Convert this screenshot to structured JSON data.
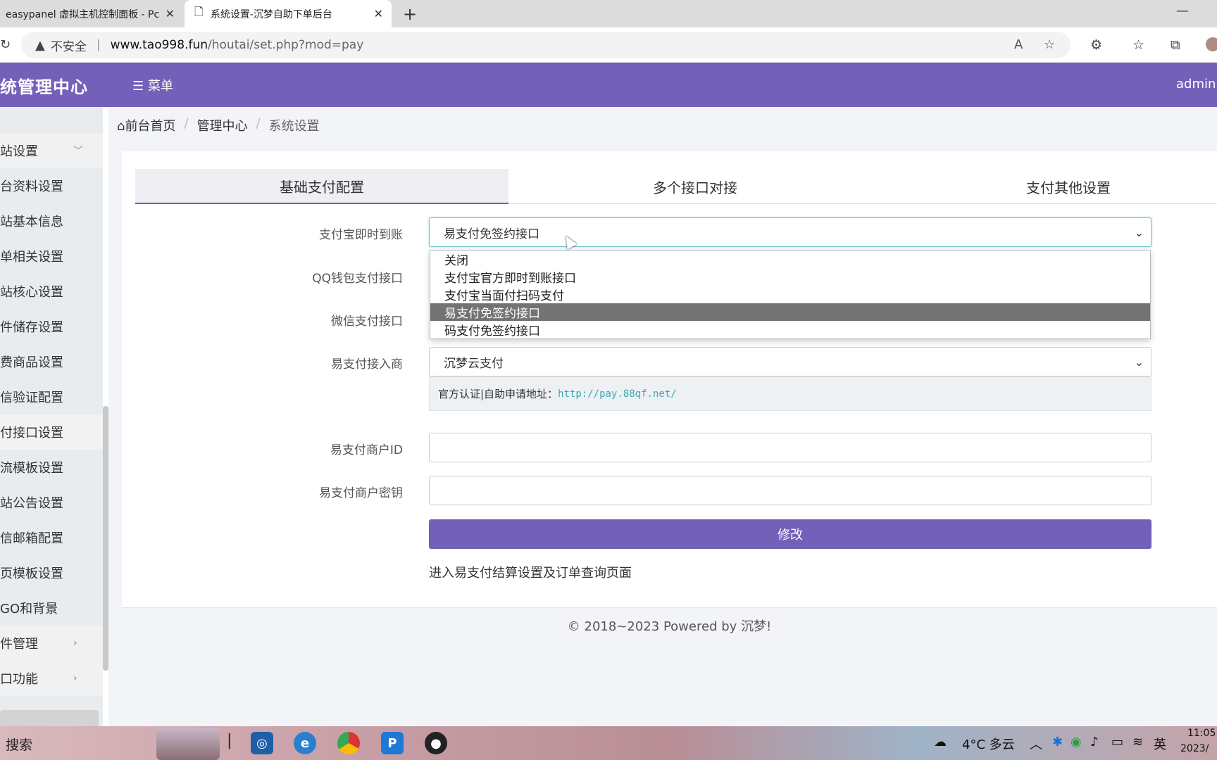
{
  "browser": {
    "tabs": [
      {
        "title": "easypanel 虚拟主机控制面板 - Pc",
        "close": "✕"
      },
      {
        "title": "系统设置-沉梦自助下单后台",
        "close": "✕"
      }
    ],
    "new_tab": "+",
    "minimize": "—",
    "security_label": "不安全",
    "url_host": "www.tao998.fun",
    "url_path": "/houtai/set.php?mod=pay",
    "read_aloud": "A",
    "favorite": "☆"
  },
  "header": {
    "brand": "统管理中心",
    "menu_label": "菜单",
    "menu_icon": "☰",
    "user": "admin"
  },
  "sidebar": {
    "items": [
      {
        "label": "站设置",
        "arrow": "﹀"
      },
      {
        "label": "台资料设置"
      },
      {
        "label": "站基本信息"
      },
      {
        "label": "单相关设置"
      },
      {
        "label": "站核心设置"
      },
      {
        "label": "件储存设置"
      },
      {
        "label": "费商品设置"
      },
      {
        "label": "信验证配置"
      },
      {
        "label": "付接口设置"
      },
      {
        "label": "流模板设置"
      },
      {
        "label": "站公告设置"
      },
      {
        "label": "信邮箱配置"
      },
      {
        "label": "页模板设置"
      },
      {
        "label": "GO和背景"
      },
      {
        "label": "件管理",
        "arrow": "›"
      },
      {
        "label": "口功能",
        "arrow": "›"
      }
    ]
  },
  "breadcrumb": {
    "home_icon": "⌂",
    "items": [
      "前台首页",
      "管理中心",
      "系统设置"
    ],
    "separator": "/"
  },
  "tabs": [
    "基础支付配置",
    "多个接口对接",
    "支付其他设置"
  ],
  "form": {
    "alipay_label": "支付宝即时到账",
    "alipay_value": "易支付免签约接口",
    "qq_label": "QQ钱包支付接口",
    "wechat_label": "微信支付接口",
    "epay_provider_label": "易支付接入商",
    "epay_provider_value": "沉梦云支付",
    "note_prefix": "官方认证|自助申请地址：",
    "note_link": "http://pay.88qf.net/",
    "merchant_id_label": "易支付商户ID",
    "merchant_id_value": "",
    "merchant_key_label": "易支付商户密钥",
    "merchant_key_value": "",
    "submit": "修改",
    "settle_link": "进入易支付结算设置及订单查询页面",
    "caret": "⌄"
  },
  "dropdown": {
    "options": [
      "关闭",
      "支付宝官方即时到账接口",
      "支付宝当面付扫码支付",
      "易支付免签约接口",
      "码支付免签约接口"
    ],
    "selected_index": 3
  },
  "footer": "© 2018~2023 Powered by 沉梦!",
  "taskbar": {
    "search": "搜索",
    "weather": "4°C 多云",
    "ime": "英",
    "time": "11:05",
    "date": "2023/"
  }
}
